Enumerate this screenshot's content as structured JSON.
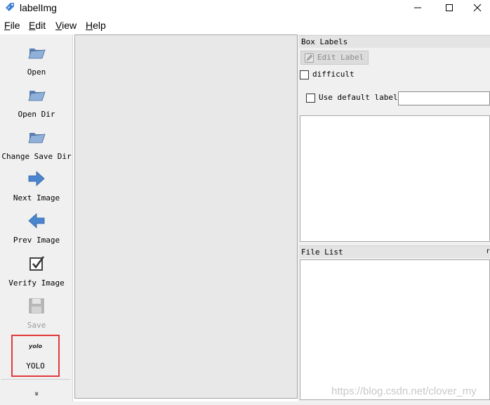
{
  "window": {
    "title": "labelImg",
    "controls": [
      "minimize",
      "maximize",
      "close"
    ]
  },
  "menu": {
    "items": [
      {
        "label": "File",
        "mnemonic": "F"
      },
      {
        "label": "Edit",
        "mnemonic": "E"
      },
      {
        "label": "View",
        "mnemonic": "V"
      },
      {
        "label": "Help",
        "mnemonic": "H"
      }
    ]
  },
  "toolbar": {
    "items": [
      {
        "label": "Open",
        "icon": "folder-open-icon",
        "enabled": true
      },
      {
        "label": "Open Dir",
        "icon": "folder-open-icon",
        "enabled": true
      },
      {
        "label": "Change Save Dir",
        "icon": "folder-open-icon",
        "enabled": true
      },
      {
        "label": "Next Image",
        "icon": "arrow-right-icon",
        "enabled": true
      },
      {
        "label": "Prev Image",
        "icon": "arrow-left-icon",
        "enabled": true
      },
      {
        "label": "Verify Image",
        "icon": "checkbox-icon",
        "enabled": true
      },
      {
        "label": "Save",
        "icon": "floppy-disk-icon",
        "enabled": false
      }
    ],
    "format": {
      "icon_text": "yolo",
      "label": "YOLO",
      "highlight_color": "#e23a3a"
    },
    "more_glyph": "»"
  },
  "box_labels": {
    "title": "Box Labels",
    "edit_label": "Edit Label",
    "difficult_label": "difficult",
    "difficult_checked": false,
    "use_default_label": "Use default label",
    "use_default_checked": false,
    "default_label_value": ""
  },
  "file_list": {
    "title": "File List",
    "float_glyph": "r"
  },
  "watermark": "https://blog.csdn.net/clover_my",
  "colors": {
    "panel_bg": "#f0f0f0",
    "canvas_bg": "#e8e8e8",
    "accent_blue": "#3d7fd6"
  }
}
